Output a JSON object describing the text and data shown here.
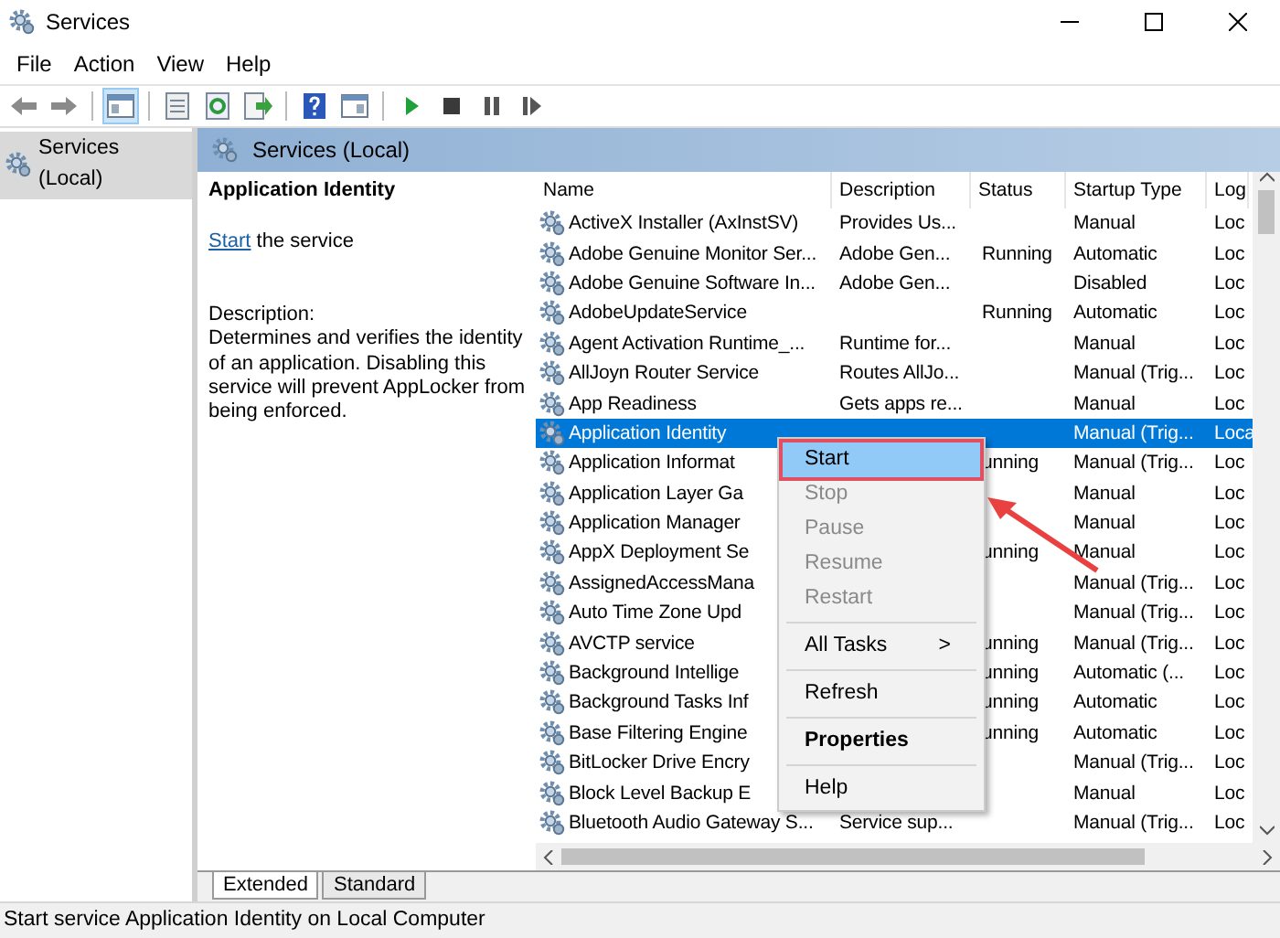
{
  "window": {
    "title": "Services"
  },
  "menu": [
    "File",
    "Action",
    "View",
    "Help"
  ],
  "tree": {
    "items": [
      {
        "label": "Services (Local)",
        "selected": true
      }
    ]
  },
  "panel_header": "Services (Local)",
  "details": {
    "title": "Application Identity",
    "action_link": "Start",
    "action_rest": " the service",
    "description_label": "Description:",
    "description": "Determines and verifies the identity of an application. Disabling this service will prevent AppLocker from being enforced."
  },
  "table": {
    "columns": [
      "Name",
      "Description",
      "Status",
      "Startup Type",
      "Log"
    ],
    "rows": [
      {
        "name": "ActiveX Installer (AxInstSV)",
        "description": "Provides Us...",
        "startup_type": "Manual",
        "log_on_as": "Loc",
        "selected": false
      },
      {
        "name": "Adobe Genuine Monitor Ser...",
        "description": "Adobe Gen...",
        "status": "Running",
        "startup_type": "Automatic",
        "log_on_as": "Loc",
        "selected": false
      },
      {
        "name": "Adobe Genuine Software In...",
        "description": "Adobe Gen...",
        "startup_type": "Disabled",
        "log_on_as": "Loc",
        "selected": false
      },
      {
        "name": "AdobeUpdateService",
        "status": "Running",
        "startup_type": "Automatic",
        "log_on_as": "Loc",
        "selected": false
      },
      {
        "name": "Agent Activation Runtime_...",
        "description": "Runtime for...",
        "startup_type": "Manual",
        "log_on_as": "Loc",
        "selected": false
      },
      {
        "name": "AllJoyn Router Service",
        "description": "Routes AllJo...",
        "startup_type": "Manual (Trig...",
        "log_on_as": "Loc",
        "selected": false
      },
      {
        "name": "App Readiness",
        "description": "Gets apps re...",
        "startup_type": "Manual",
        "log_on_as": "Loc",
        "selected": false
      },
      {
        "name": "Application Identity",
        "startup_type": "Manual (Trig...",
        "log_on_as": "Loca",
        "selected": true
      },
      {
        "name": "Application Informat",
        "status": "unning",
        "startup_type": "Manual (Trig...",
        "log_on_as": "Loc",
        "selected": false
      },
      {
        "name": "Application Layer Ga",
        "startup_type": "Manual",
        "log_on_as": "Loc",
        "selected": false
      },
      {
        "name": "Application Manager",
        "startup_type": "Manual",
        "log_on_as": "Loc",
        "selected": false
      },
      {
        "name": "AppX Deployment Se",
        "status": "unning",
        "startup_type": "Manual",
        "log_on_as": "Loc",
        "selected": false
      },
      {
        "name": "AssignedAccessMana",
        "startup_type": "Manual (Trig...",
        "log_on_as": "Loc",
        "selected": false
      },
      {
        "name": "Auto Time Zone Upd",
        "startup_type": "Manual (Trig...",
        "log_on_as": "Loc",
        "selected": false
      },
      {
        "name": "AVCTP service",
        "status": "unning",
        "startup_type": "Manual (Trig...",
        "log_on_as": "Loc",
        "selected": false
      },
      {
        "name": "Background Intellige",
        "status": "unning",
        "startup_type": "Automatic (...",
        "log_on_as": "Loc",
        "selected": false
      },
      {
        "name": "Background Tasks Inf",
        "status": "unning",
        "startup_type": "Automatic",
        "log_on_as": "Loc",
        "selected": false
      },
      {
        "name": "Base Filtering Engine",
        "status": "unning",
        "startup_type": "Automatic",
        "log_on_as": "Loc",
        "selected": false
      },
      {
        "name": "BitLocker Drive Encry",
        "startup_type": "Manual (Trig...",
        "log_on_as": "Loc",
        "selected": false
      },
      {
        "name": "Block Level Backup E",
        "startup_type": "Manual",
        "log_on_as": "Loc",
        "selected": false
      },
      {
        "name": "Bluetooth Audio Gateway S...",
        "description": "Service sup...",
        "startup_type": "Manual (Trig...",
        "log_on_as": "Loc",
        "selected": false
      }
    ]
  },
  "context_menu": [
    {
      "kind": "item",
      "label": "Start",
      "disabled": false,
      "selected": true
    },
    {
      "kind": "item",
      "label": "Stop",
      "disabled": true,
      "selected": false
    },
    {
      "kind": "item",
      "label": "Pause",
      "disabled": true,
      "selected": false
    },
    {
      "kind": "item",
      "label": "Resume",
      "disabled": true,
      "selected": false
    },
    {
      "kind": "item",
      "label": "Restart",
      "disabled": true,
      "selected": false
    },
    {
      "kind": "separator"
    },
    {
      "kind": "submenu",
      "label": "All Tasks",
      "arrow": ">",
      "disabled": false,
      "selected": false
    },
    {
      "kind": "separator"
    },
    {
      "kind": "item",
      "label": "Refresh",
      "disabled": false,
      "selected": false
    },
    {
      "kind": "separator"
    },
    {
      "kind": "default",
      "label": "Properties",
      "disabled": false,
      "selected": false
    },
    {
      "kind": "separator"
    },
    {
      "kind": "item",
      "label": "Help",
      "disabled": false,
      "selected": false
    }
  ],
  "view_tabs": [
    {
      "label": "Extended",
      "selected": true
    },
    {
      "label": "Standard",
      "selected": false
    }
  ],
  "status_bar": "Start service Application Identity on Local Computer"
}
